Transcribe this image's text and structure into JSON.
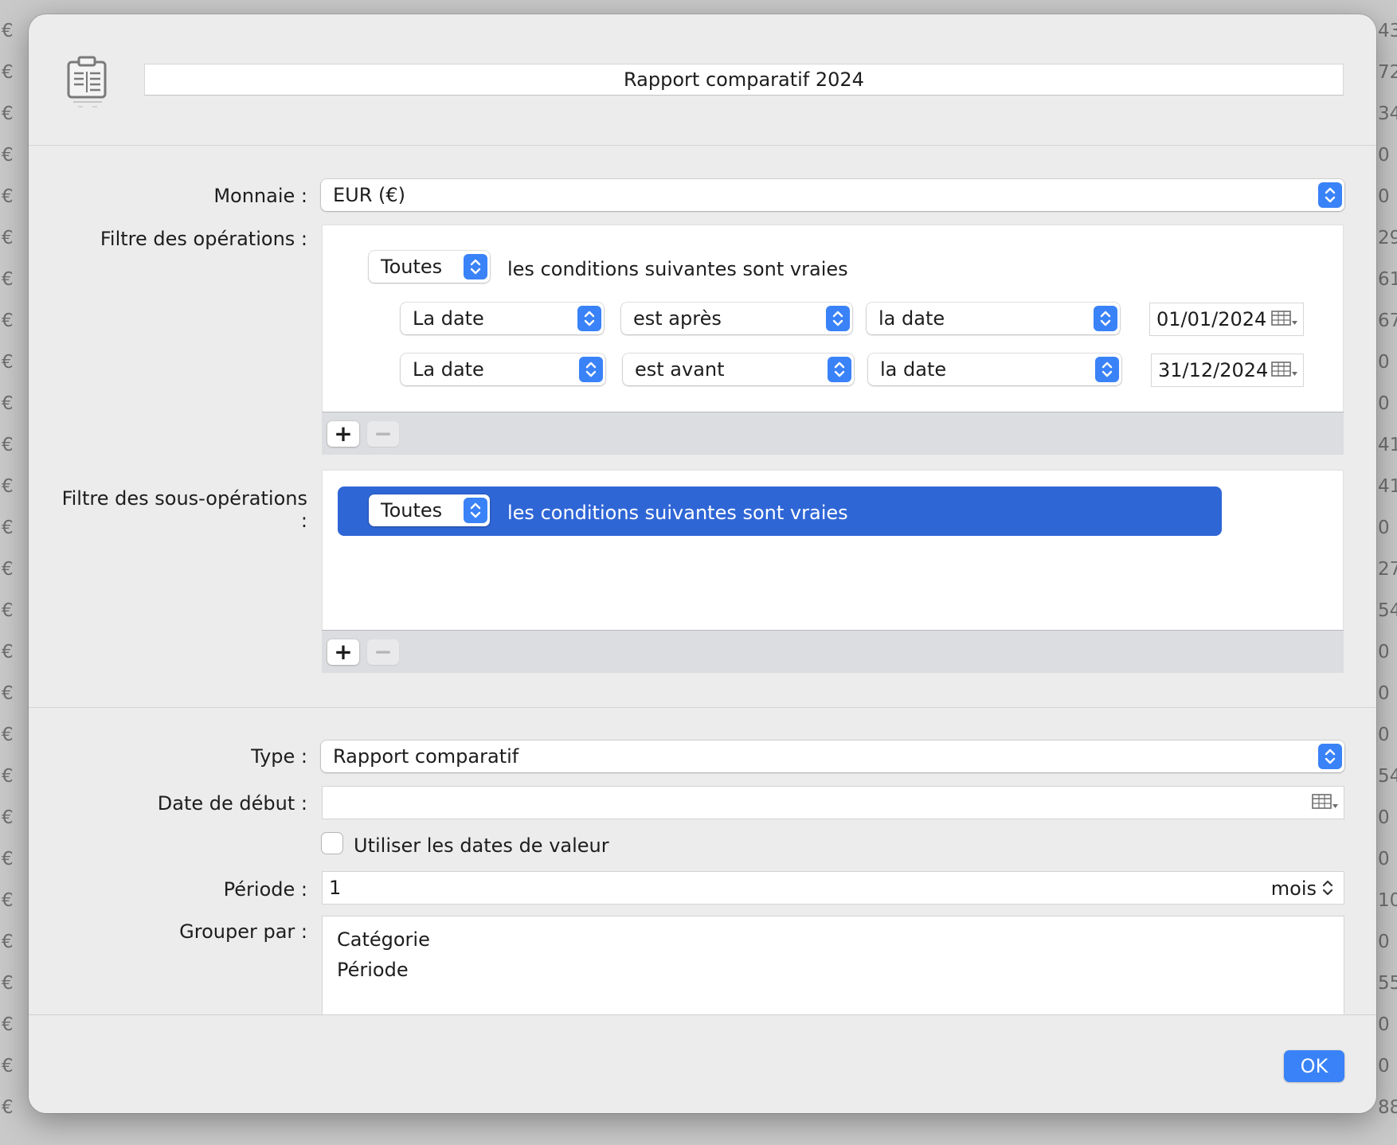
{
  "background": {
    "currency_symbol": "€",
    "right_column": [
      "43",
      "72",
      "34",
      "0",
      "0",
      "29",
      "61",
      "67",
      "0",
      "0",
      "41",
      "41",
      "0",
      "27",
      "54",
      "0",
      "0",
      "0",
      "54",
      "0",
      "0",
      "10",
      "0",
      "55",
      "0",
      "0",
      "88"
    ]
  },
  "header": {
    "icon": "report-clipboard-icon",
    "title": "Rapport comparatif 2024"
  },
  "currency": {
    "label": "Monnaie :",
    "value": "EUR (€)"
  },
  "operations_filter": {
    "label": "Filtre des opérations :",
    "match_value": "Toutes",
    "match_text": "les conditions suivantes sont vraies",
    "rules": [
      {
        "field": "La date",
        "operator": "est après",
        "operand": "la date",
        "date": "01/01/2024"
      },
      {
        "field": "La date",
        "operator": "est avant",
        "operand": "la date",
        "date": "31/12/2024"
      }
    ],
    "add_label": "+",
    "remove_label": "−"
  },
  "suboperations_filter": {
    "label": "Filtre des sous-opérations :",
    "match_value": "Toutes",
    "match_text": "les conditions suivantes sont vraies",
    "add_label": "+",
    "remove_label": "−"
  },
  "type": {
    "label": "Type :",
    "value": "Rapport comparatif"
  },
  "start_date": {
    "label": "Date de début :",
    "value": ""
  },
  "value_dates": {
    "label": "Utiliser les dates de valeur",
    "checked": false
  },
  "period": {
    "label": "Période :",
    "value": "1",
    "unit": "mois"
  },
  "group_by": {
    "label": "Grouper par :",
    "items": [
      "Catégorie",
      "Période"
    ]
  },
  "footer": {
    "ok_label": "OK"
  },
  "colors": {
    "accent": "#3a82f7",
    "selection": "#2f66d6"
  }
}
